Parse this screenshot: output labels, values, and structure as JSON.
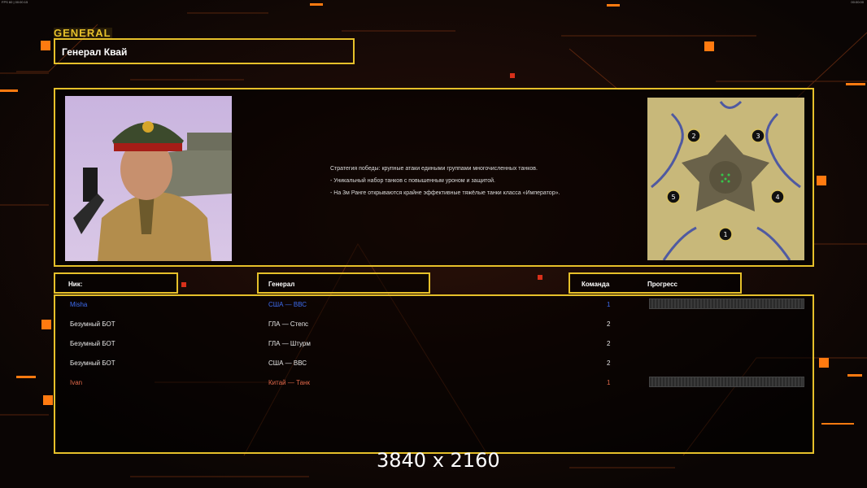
{
  "system": {
    "top_left": "FPS 60 | 00:00:15",
    "top_right": "00:00:00"
  },
  "header": {
    "logo_text": "GENERAL",
    "title": "Генерал Квай"
  },
  "description": {
    "lines": [
      "Стратегия победы: крупные атаки едиными группами многочисленных танков.",
      "- Уникальный набор танков с повышенным уроном и защитой.",
      "- На 3м Ранге открываются крайне эффективные тяжёлые танки класса «Император»."
    ]
  },
  "columns": {
    "nick": "Ник:",
    "general": "Генерал",
    "team": "Команда",
    "progress": "Прогресс"
  },
  "players": [
    {
      "nick": "Misha",
      "general": "США — ВВС",
      "team": "1",
      "color": "#3d6cf0",
      "has_progress": true
    },
    {
      "nick": "Безумный БОТ",
      "general": "ГЛА — Степс",
      "team": "2",
      "color": "#e0e0e0",
      "has_progress": false
    },
    {
      "nick": "Безумный БОТ",
      "general": "ГЛА — Штурм",
      "team": "2",
      "color": "#e0e0e0",
      "has_progress": false
    },
    {
      "nick": "Безумный БОТ",
      "general": "США — ВВС",
      "team": "2",
      "color": "#e0e0e0",
      "has_progress": false
    },
    {
      "nick": "Ivan",
      "general": "Китай — Танк",
      "team": "1",
      "color": "#e0684a",
      "has_progress": true
    }
  ],
  "map": {
    "start_positions": [
      "1",
      "2",
      "3",
      "4",
      "5"
    ]
  },
  "resolution_label": "3840 x 2160",
  "colors": {
    "accent_gold": "#e6c02a",
    "ui_orange": "#ff7a10"
  }
}
